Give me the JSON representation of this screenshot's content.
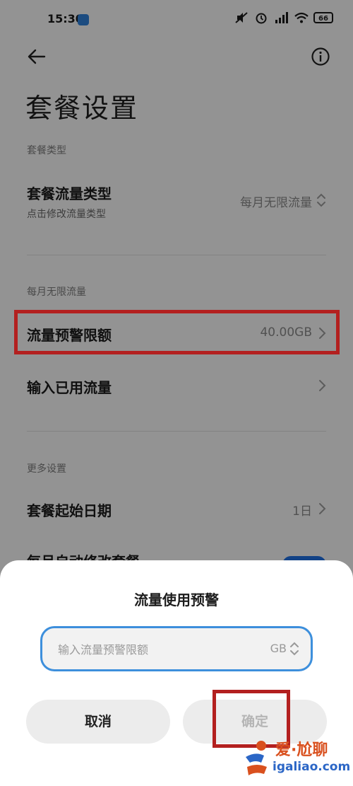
{
  "status_bar": {
    "time": "15:30",
    "battery": "66"
  },
  "header": {
    "title": "套餐设置"
  },
  "sections": {
    "plan_type": {
      "label": "套餐类型",
      "row_title": "套餐流量类型",
      "row_sub": "点击修改流量类型",
      "row_value": "每月无限流量"
    },
    "monthly": {
      "label": "每月无限流量",
      "alert_title": "流量预警限额",
      "alert_value": "40.00GB",
      "used_title": "输入已用流量"
    },
    "more": {
      "label": "更多设置",
      "start_title": "套餐起始日期",
      "start_value": "1日",
      "auto_title": "每月自动修改套餐"
    }
  },
  "dialog": {
    "title": "流量使用预警",
    "input_placeholder": "输入流量预警限额",
    "input_unit": "GB",
    "cancel_label": "取消",
    "confirm_label": "确定"
  },
  "watermark": {
    "brand": "爱·尬聊",
    "url": "igaliao.com"
  }
}
